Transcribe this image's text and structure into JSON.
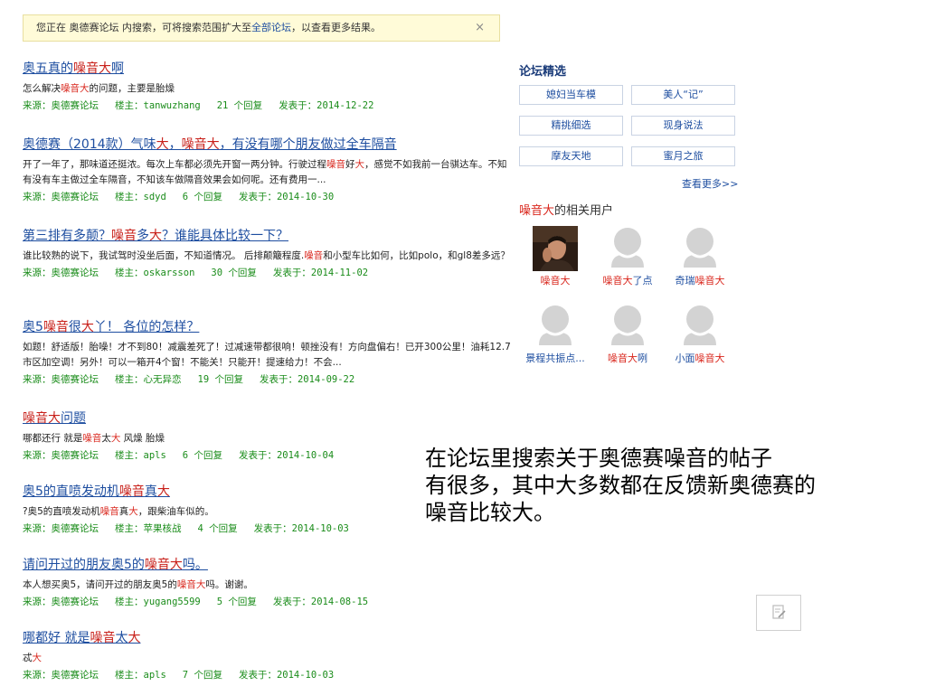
{
  "notice": {
    "prefix": "您正在 奥德赛论坛 内搜索，可将搜索范围扩大至",
    "link": "全部论坛",
    "suffix": "，以查看更多结果。",
    "close": "×"
  },
  "results": [
    {
      "title": [
        "奥五真的",
        "噪音大",
        "啊"
      ],
      "snippet": [
        "怎么解决",
        "噪音大",
        "的问题，主要是胎燥"
      ],
      "source_label": "来源：奥德赛论坛",
      "author_label": "楼主：tanwuzhang",
      "replies": "21 个回复",
      "date": "发表于：2014-12-22"
    },
    {
      "title": [
        "奥德赛（2014款）气味",
        "大",
        "，",
        "噪音大",
        "，有没有哪个朋友做过全车隔音"
      ],
      "snippet": [
        "开了一年了，那味道还挺浓。每次上车都必须先开窗一两分钟。行驶过程",
        "噪音",
        "好",
        "大",
        "，感觉不如我前一台骐达车。不知有没有车主做过全车隔音，不知该车做隔音效果会如何呢。还有费用一..."
      ],
      "source_label": "来源：奥德赛论坛",
      "author_label": "楼主：sdyd",
      "replies": "6 个回复",
      "date": "发表于：2014-10-30"
    },
    {
      "title": [
        "第三排有多颠？",
        "噪音",
        "多",
        "大",
        "？谁能具体比较一下？"
      ],
      "snippet": [
        "谁比较熟的说下，我试驾时没坐后面，不知道情况。 后排颠簸程度.",
        "噪音",
        "和小型车比如何，比如polo，和gl8差多远？"
      ],
      "source_label": "来源：奥德赛论坛",
      "author_label": "楼主：oskarsson",
      "replies": "30 个回复",
      "date": "发表于：2014-11-02"
    },
    {
      "title": [
        "奥5",
        "噪音",
        "很",
        "大",
        "丫！ 各位的怎样？"
      ],
      "snippet": [
        "如题！舒适版！胎噪！才不到80！减震差死了！过减速带都很响！顿挫没有！方向盘偏右！已开300公里！油耗12.7市区加空调！另外！可以一箱开4个窗！不能关！只能开！提速给力！不会..."
      ],
      "source_label": "来源：奥德赛论坛",
      "author_label": "楼主：心无异恋",
      "replies": "19 个回复",
      "date": "发表于：2014-09-22"
    },
    {
      "title": [
        "噪音大",
        "问题"
      ],
      "snippet": [
        "哪都还行 就是",
        "噪音",
        "太",
        "大",
        " 风燥 胎燥"
      ],
      "source_label": "来源：奥德赛论坛",
      "author_label": "楼主：apls",
      "replies": "6 个回复",
      "date": "发表于：2014-10-04"
    },
    {
      "title": [
        "奥5的直喷发动机",
        "噪音",
        "真",
        "大"
      ],
      "snippet": [
        "?奥5的直喷发动机",
        "噪音",
        "真",
        "大",
        "，跟柴油车似的。"
      ],
      "source_label": "来源：奥德赛论坛",
      "author_label": "楼主：苹果核战",
      "replies": "4 个回复",
      "date": "发表于：2014-10-03"
    },
    {
      "title": [
        "请问开过的朋友奥5的",
        "噪音大",
        "吗。"
      ],
      "snippet": [
        "本人想买奥5，请问开过的朋友奥5的",
        "噪音大",
        "吗。谢谢。"
      ],
      "source_label": "来源：奥德赛论坛",
      "author_label": "楼主：yugang5599",
      "replies": "5 个回复",
      "date": "发表于：2014-08-15"
    },
    {
      "title": [
        "哪都好 就是",
        "噪音",
        "太",
        "大"
      ],
      "snippet": [
        "忒",
        "大"
      ],
      "source_label": "来源：奥德赛论坛",
      "author_label": "楼主：apls",
      "replies": "7 个回复",
      "date": "发表于：2014-10-03"
    }
  ],
  "sidebar": {
    "title": "论坛精选",
    "buttons": [
      "媳妇当车模",
      "美人“记”",
      "精挑细选",
      "现身说法",
      "摩友天地",
      "蜜月之旅"
    ],
    "more": "查看更多>>",
    "users_title_hl": "噪音大",
    "users_title_rest": "的相关用户",
    "users": [
      {
        "pre": "",
        "hl": "噪音大",
        "post": "",
        "photo": true
      },
      {
        "pre": "",
        "hl": "噪音大",
        "post": "了点",
        "photo": false
      },
      {
        "pre": "奇瑞",
        "hl": "噪音大",
        "post": "",
        "photo": false
      },
      {
        "pre": "景程共振点...",
        "hl": "",
        "post": "",
        "photo": false
      },
      {
        "pre": "",
        "hl": "噪音大",
        "post": "咧",
        "photo": false
      },
      {
        "pre": "小面",
        "hl": "噪音大",
        "post": "",
        "photo": false
      }
    ]
  },
  "annotation": {
    "line1": "在论坛里搜索关于奥德赛噪音的帖子",
    "line2": "有很多，其中大多数都在反馈新奥德赛的",
    "line3": "噪音比较大。"
  },
  "colors": {
    "link": "#1e4ea0",
    "highlight": "#d9261c",
    "meta": "#1a8c1a"
  },
  "icons": {
    "close": "close-icon",
    "edit": "edit-icon",
    "avatar": "default-avatar-icon"
  }
}
